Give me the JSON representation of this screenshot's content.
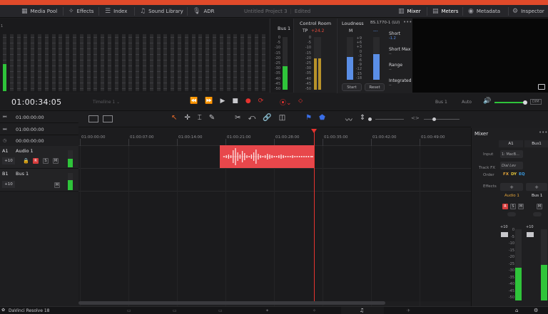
{
  "toolbar": {
    "media_pool": "Media Pool",
    "effects": "Effects",
    "index": "Index",
    "sound_library": "Sound Library",
    "adr": "ADR",
    "project_title": "Untitled Project 3",
    "project_state": "Edited",
    "mixer": "Mixer",
    "meters": "Meters",
    "metadata": "Metadata",
    "inspector": "Inspector"
  },
  "meters_panel": {
    "bus_label": "Bus 1",
    "bus_scale": [
      "0",
      "-5",
      "-10",
      "-15",
      "-20",
      "-25",
      "-30",
      "-35",
      "-40",
      "-45",
      "-50"
    ],
    "bus_level_fraction": 0.45
  },
  "control_room": {
    "title": "Control Room",
    "tp_label": "TP",
    "tp_value": "+24.2",
    "scale": [
      "0",
      "-5",
      "-10",
      "-15",
      "-20",
      "-25",
      "-30",
      "-35",
      "-40",
      "-45",
      "-50"
    ],
    "level_fraction": 0.6
  },
  "loudness": {
    "title": "Loudness",
    "standard": "BS.1770-1 (LU)",
    "m_label": "M",
    "short_label": "Short",
    "short_value": "-1.2",
    "short_max_label": "Short Max",
    "short_max_value": "--",
    "range_label": "Range",
    "range_value": "--",
    "integrated_label": "Integrated",
    "integrated_value": "--",
    "scale": [
      "+9",
      "+6",
      "+3",
      "0",
      "-3",
      "-6",
      "-9",
      "-12",
      "-15",
      "-18"
    ],
    "start_button": "Start",
    "reset_button": "Reset",
    "more_icon": "•••"
  },
  "transport": {
    "timecode": "01:00:34:05",
    "timeline_name": "Timeline 1",
    "bus_output": "Bus 1",
    "automation": "Auto",
    "dim_label": "DIM"
  },
  "left_timecodes": [
    "01:00:00:00",
    "01:00:00:00",
    "00:00:00:00"
  ],
  "ruler": [
    "01:00:00:00",
    "01:00:07:00",
    "01:00:14:00",
    "01:00:21:00",
    "01:00:28:00",
    "01:00:35:00",
    "01:00:42:00",
    "01:00:49:00"
  ],
  "tracks": [
    {
      "id": "A1",
      "name": "Audio 1",
      "gain": "+10",
      "r": "R",
      "s": "S",
      "m": "M"
    },
    {
      "id": "B1",
      "name": "Bus 1",
      "gain": "+10",
      "m": "M"
    }
  ],
  "mixer_panel": {
    "title": "Mixer",
    "ch1": "A1",
    "ch2": "Bus1",
    "input_label": "Input",
    "input_value": "1: MacB...",
    "track_fx_label": "Track FX",
    "track_fx_value": "Dial Lev",
    "order_label": "Order",
    "order_value": [
      "FX",
      "DY",
      "EQ"
    ],
    "effects_label": "Effects",
    "add": "+",
    "audio1": "Audio 1",
    "bus1": "Bus 1",
    "fader_value": "+10",
    "fader_scale": [
      "0",
      "-5",
      "-10",
      "-15",
      "-20",
      "-25",
      "-30",
      "-35",
      "-40",
      "-45",
      "-50"
    ],
    "r": "R",
    "s": "S",
    "m": "M",
    "more_icon": "•••"
  },
  "footer": {
    "app_name": "DaVinci Resolve 18"
  },
  "colors": {
    "clip_red": "#e8474b",
    "playhead": "#e6332f",
    "meter_green": "#2fc43a",
    "meter_yellow": "#b8922a",
    "loudness_blue": "#5a8ee6",
    "accent_orange": "#e0a23a"
  }
}
